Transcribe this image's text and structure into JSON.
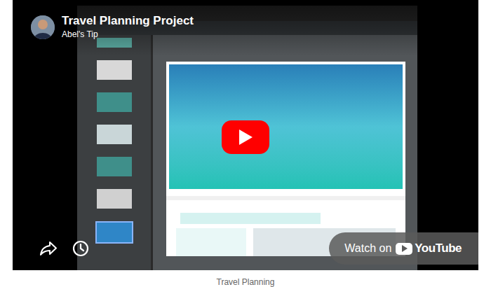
{
  "video": {
    "title": "Travel Planning Project",
    "channel": "Abel's Tip",
    "watch_on": {
      "label": "Watch on",
      "logo_text": "YouTube"
    }
  },
  "caption": "Travel Planning"
}
